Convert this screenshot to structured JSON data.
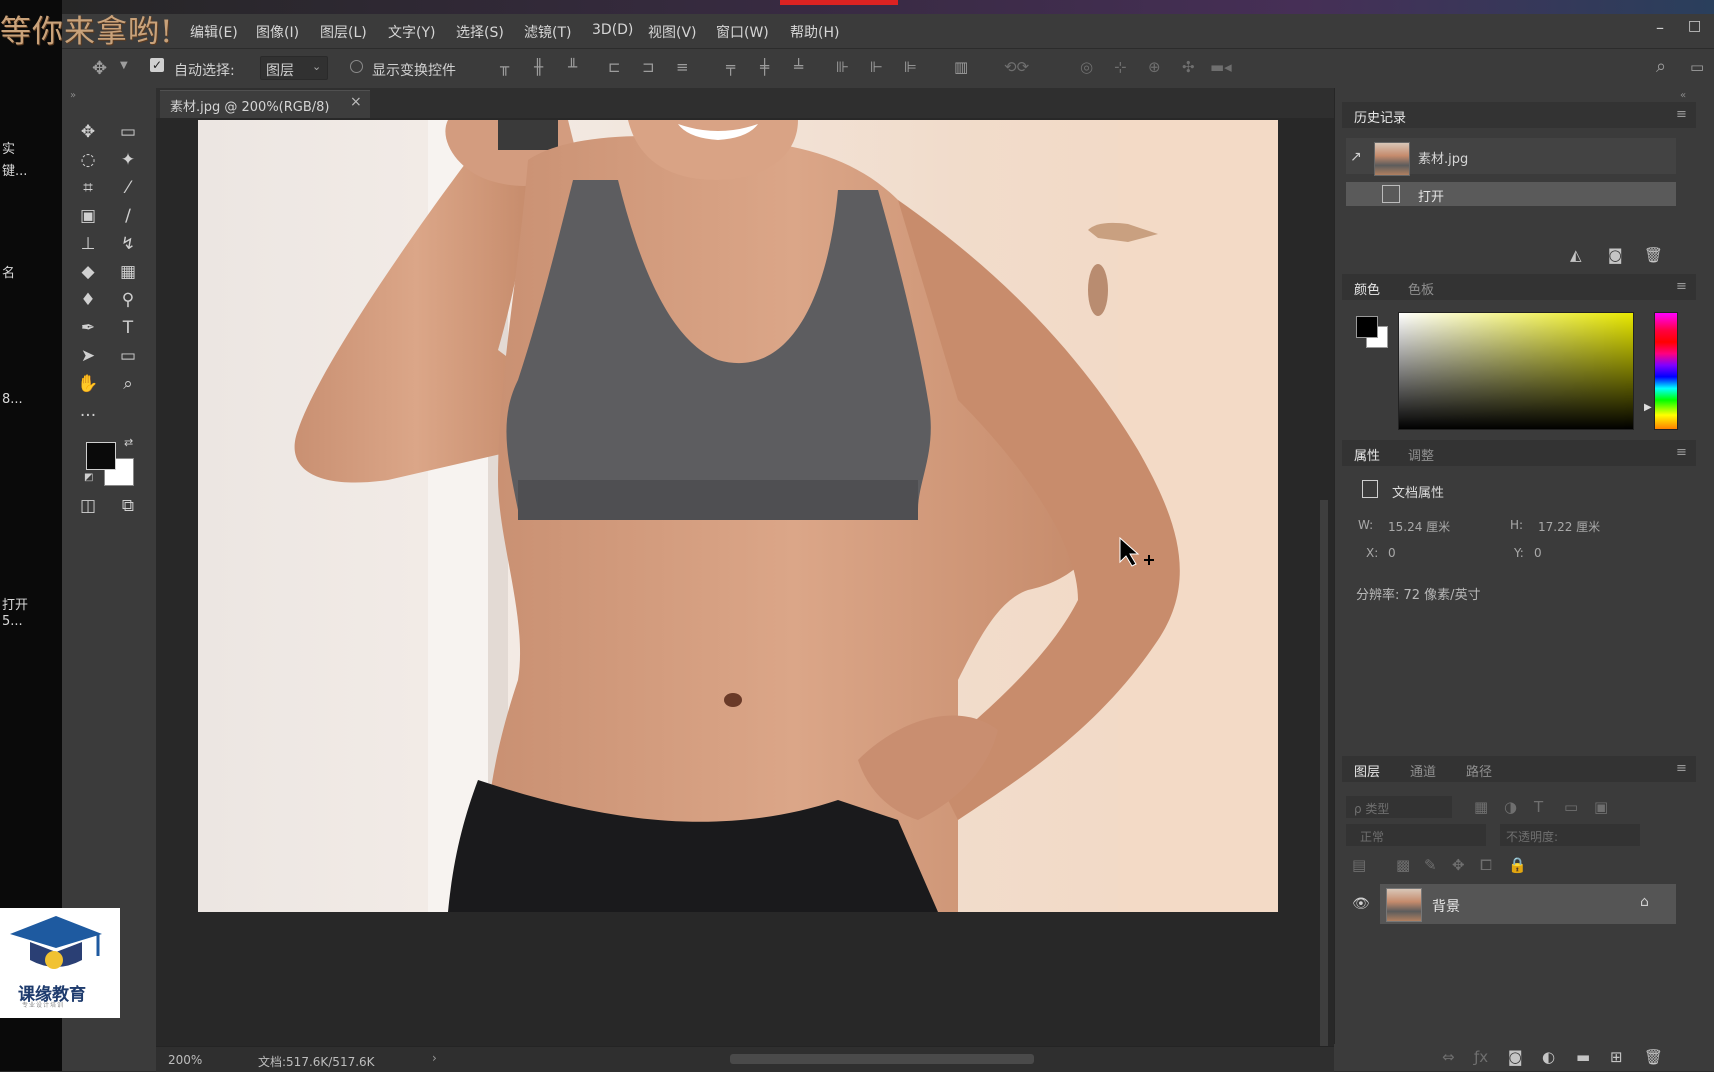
{
  "overlay_banner": "等你来拿哟!",
  "left_strip_fragments": [
    "实",
    "键...",
    "名",
    "8...",
    "打开",
    "5..."
  ],
  "menu": [
    "编辑(E)",
    "图像(I)",
    "图层(L)",
    "文字(Y)",
    "选择(S)",
    "滤镜(T)",
    "3D(D)",
    "视图(V)",
    "窗口(W)",
    "帮助(H)"
  ],
  "window_controls": {
    "minimize": "–",
    "maximize": "□"
  },
  "options_bar": {
    "auto_select_label": "自动选择:",
    "layer_select_value": "图层",
    "show_transform_label": "显示变换控件"
  },
  "document_tab": {
    "label": "素材.jpg @ 200%(RGB/8)",
    "close": "×"
  },
  "status": {
    "zoom": "200%",
    "doc_size": "文档:517.6K/517.6K",
    "arrow": "›"
  },
  "panels": {
    "history": {
      "tab": "历史记录",
      "items": [
        {
          "label": "素材.jpg"
        },
        {
          "label": "打开"
        }
      ]
    },
    "color": {
      "tabs": [
        "颜色",
        "色板"
      ],
      "fg": "#000000",
      "bg": "#ffffff"
    },
    "properties": {
      "tabs": [
        "属性",
        "调整"
      ],
      "doc_label": "文档属性",
      "w_label": "W:",
      "w_value": "15.24 厘米",
      "h_label": "H:",
      "h_value": "17.22 厘米",
      "x_label": "X:",
      "x_value": "0",
      "y_label": "Y:",
      "y_value": "0",
      "resolution": "分辨率: 72 像素/英寸"
    },
    "layers": {
      "tabs": [
        "图层",
        "通道",
        "路径"
      ],
      "search_placeholder": "ρ 类型",
      "blend_mode": "正常",
      "opacity_label": "不透明度:",
      "layer_name": "背景"
    }
  },
  "logo": {
    "name": "课缘教育",
    "tagline": "专业设计培训"
  },
  "colors": {
    "accent": "#c9a27a",
    "panel": "#3b3b3b",
    "dark": "#2b2b2b"
  }
}
